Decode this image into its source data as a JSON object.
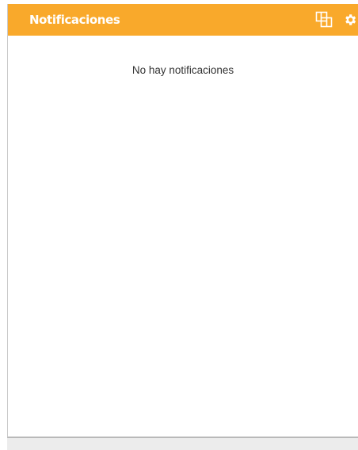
{
  "panel": {
    "title": "Notificaciones",
    "empty_message": "No hay notificaciones",
    "icons": {
      "windows": "windows-toggle-icon",
      "settings": "gear-icon"
    }
  },
  "colors": {
    "header": "#f9a92b",
    "title_text": "#ffffff",
    "body_text": "#333333"
  }
}
